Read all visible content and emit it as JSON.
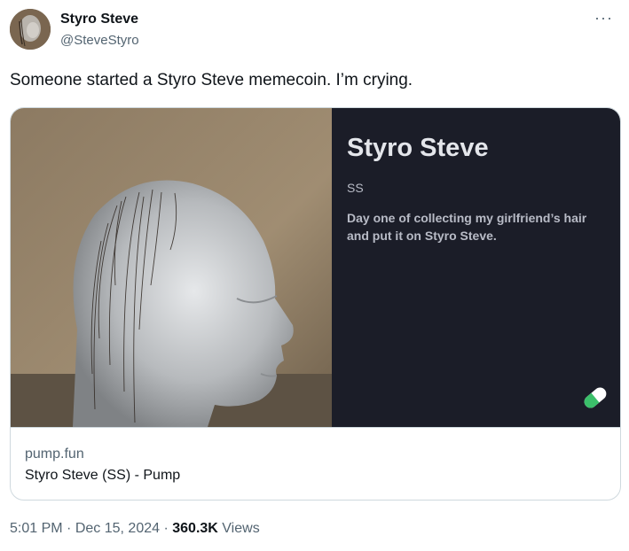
{
  "author": {
    "name": "Styro Steve",
    "handle": "@SteveStyro"
  },
  "more_glyph": "···",
  "tweet": {
    "text": "Someone started a Styro Steve memecoin. I’m crying."
  },
  "card": {
    "title": "Styro Steve",
    "ticker": "SS",
    "description": "Day one of collecting my girlfriend’s hair and put it on Styro Steve.",
    "domain": "pump.fun",
    "link_title": "Styro Steve (SS) - Pump"
  },
  "meta": {
    "time": "5:01 PM",
    "separator": "·",
    "date": "Dec 15, 2024",
    "views_count": "360.3K",
    "views_label": "Views"
  },
  "colors": {
    "card_panel": "#1b1d28",
    "pill_green": "#3bbf6a"
  }
}
